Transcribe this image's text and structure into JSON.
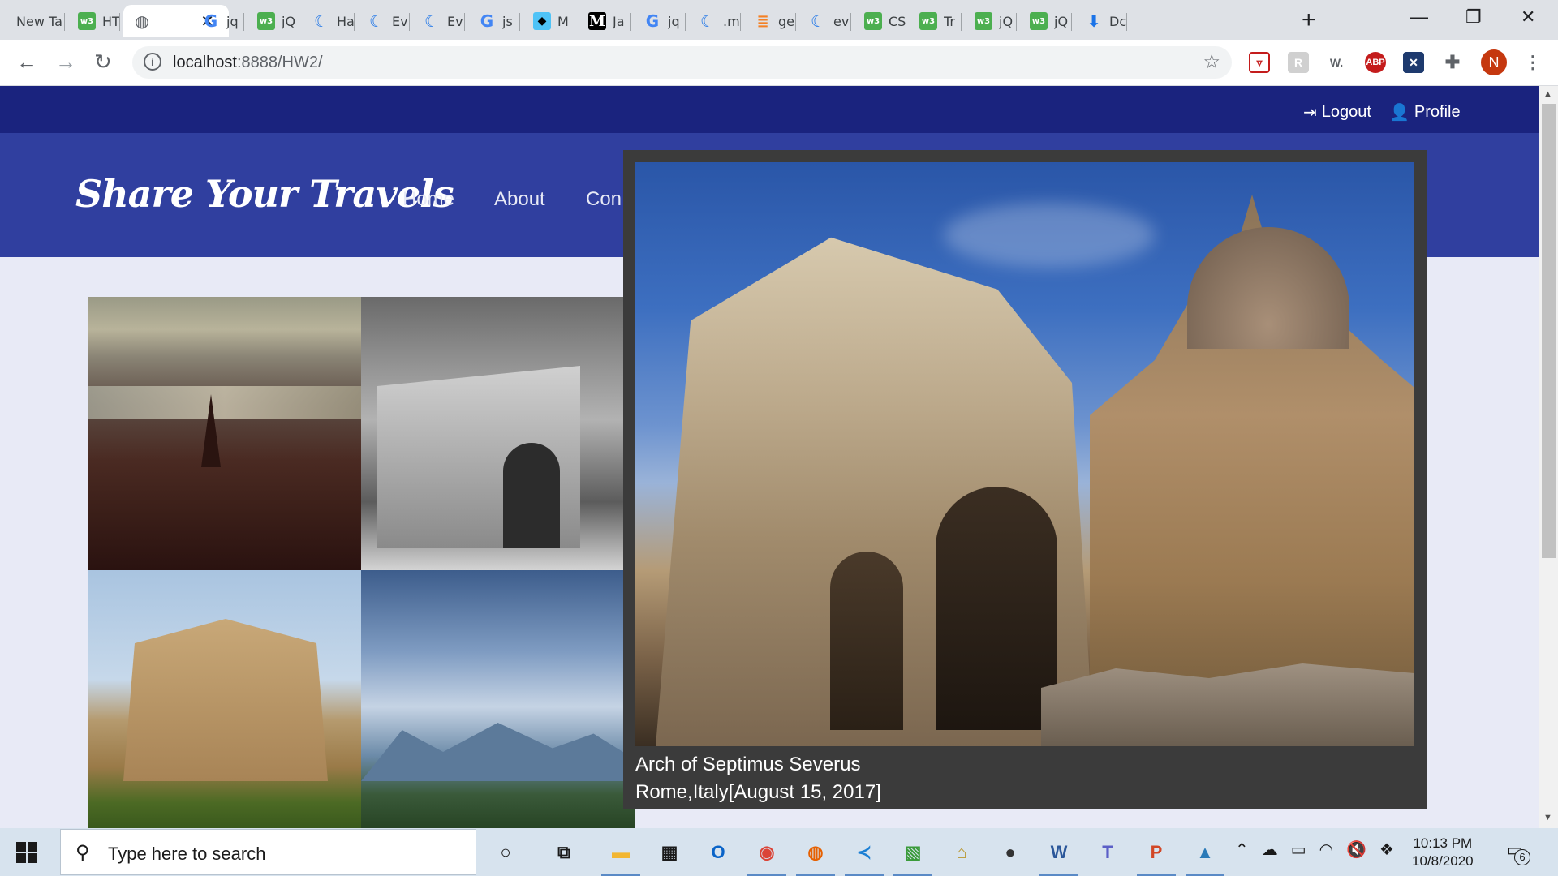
{
  "browser": {
    "tabs": [
      {
        "label": "New Ta",
        "icon": "none"
      },
      {
        "label": "HT",
        "icon": "w3schools-icon"
      },
      {
        "label": "",
        "icon": "globe-icon",
        "active": true
      },
      {
        "label": "jq",
        "icon": "google-icon"
      },
      {
        "label": "jQ",
        "icon": "w3schools-icon"
      },
      {
        "label": "Ha",
        "icon": "wave-icon"
      },
      {
        "label": "Ev",
        "icon": "wave-icon"
      },
      {
        "label": "Ev",
        "icon": "wave-icon"
      },
      {
        "label": "js",
        "icon": "google-icon"
      },
      {
        "label": "M",
        "icon": "hat-icon"
      },
      {
        "label": "Ja",
        "icon": "medium-icon"
      },
      {
        "label": "jq",
        "icon": "google-icon"
      },
      {
        "label": ".m",
        "icon": "wave-icon"
      },
      {
        "label": "ge",
        "icon": "stackoverflow-icon"
      },
      {
        "label": "ev",
        "icon": "wave-icon"
      },
      {
        "label": "CS",
        "icon": "w3schools-icon"
      },
      {
        "label": "Tr",
        "icon": "w3schools-icon"
      },
      {
        "label": "jQ",
        "icon": "w3schools-icon"
      },
      {
        "label": "jQ",
        "icon": "w3schools-icon"
      },
      {
        "label": "Dc",
        "icon": "download-icon"
      }
    ],
    "close_glyph": "✕",
    "new_tab_glyph": "+",
    "url_host": "localhost",
    "url_rest": ":8888/HW2/",
    "extensions": {
      "w_label": "W.",
      "abp_label": "ABP",
      "avatar_letter": "N"
    }
  },
  "site": {
    "top_links": {
      "logout": "Logout",
      "profile": "Profile"
    },
    "brand": "Share Your Travels",
    "nav": [
      "Home",
      "About",
      "Con"
    ]
  },
  "lightbox": {
    "title": "Arch of Septimus Severus",
    "location": "Rome,Italy[August 15, 2017]"
  },
  "taskbar": {
    "search_placeholder": "Type here to search",
    "time": "10:13 PM",
    "date": "10/8/2020",
    "notification_count": "6",
    "apps": [
      {
        "name": "cortana-icon",
        "glyph": "○",
        "color": "#1a1a1a"
      },
      {
        "name": "task-view-icon",
        "glyph": "⧉",
        "color": "#1a1a1a"
      },
      {
        "name": "file-explorer-icon",
        "glyph": "▬",
        "color": "#f2b631"
      },
      {
        "name": "store-icon",
        "glyph": "▦",
        "color": "#1a1a1a"
      },
      {
        "name": "outlook-icon",
        "glyph": "O",
        "color": "#0a64c8"
      },
      {
        "name": "chrome-icon",
        "glyph": "◉",
        "color": "#db4437"
      },
      {
        "name": "firefox-icon",
        "glyph": "◍",
        "color": "#e66000"
      },
      {
        "name": "vscode-icon",
        "glyph": "≺",
        "color": "#1a7fd4"
      },
      {
        "name": "photo-app-icon",
        "glyph": "▧",
        "color": "#3a9b3a"
      },
      {
        "name": "lock-app-icon",
        "glyph": "⌂",
        "color": "#b8962e"
      },
      {
        "name": "github-icon",
        "glyph": "●",
        "color": "#333333"
      },
      {
        "name": "word-icon",
        "glyph": "W",
        "color": "#2b579a"
      },
      {
        "name": "teams-icon",
        "glyph": "T",
        "color": "#5b5fc7"
      },
      {
        "name": "powerpoint-icon",
        "glyph": "P",
        "color": "#d24726"
      },
      {
        "name": "photos-icon",
        "glyph": "▲",
        "color": "#2a7ab8"
      }
    ]
  }
}
